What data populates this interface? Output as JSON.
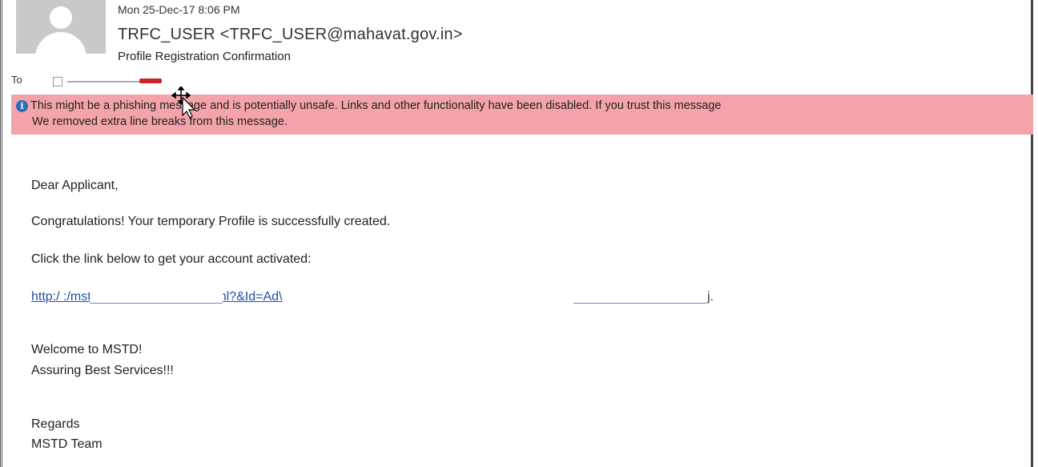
{
  "header": {
    "date": "Mon 25-Dec-17 8:06 PM",
    "sender": "TRFC_USER <TRFC_USER@mahavat.gov.in>",
    "subject": "Profile Registration Confirmation",
    "to_label": "To"
  },
  "banner": {
    "line1": "This might be a phishing message and is potentially unsafe. Links and other functionality have been disabled. If you trust this message",
    "line2": "We removed extra line breaks from this message.",
    "color": "#f4a3ab"
  },
  "message": {
    "greeting": "Dear Applicant,",
    "congrats": "Congratulations! Your temporary Profile is successfully created.",
    "instruction": "Click the link below to get your account activated:",
    "link": "http:/                        :/mstd/practivation/index.html?&Id=Ad\\",
    "link_tail": "j.",
    "welcome": "Welcome to MSTD!",
    "tagline": "Assuring Best Services!!!",
    "regards": "Regards",
    "team": "MSTD Team"
  },
  "icons": {
    "avatar": "person-avatar-icon",
    "info": "info-icon",
    "cursor": "move-cursor-icon"
  }
}
